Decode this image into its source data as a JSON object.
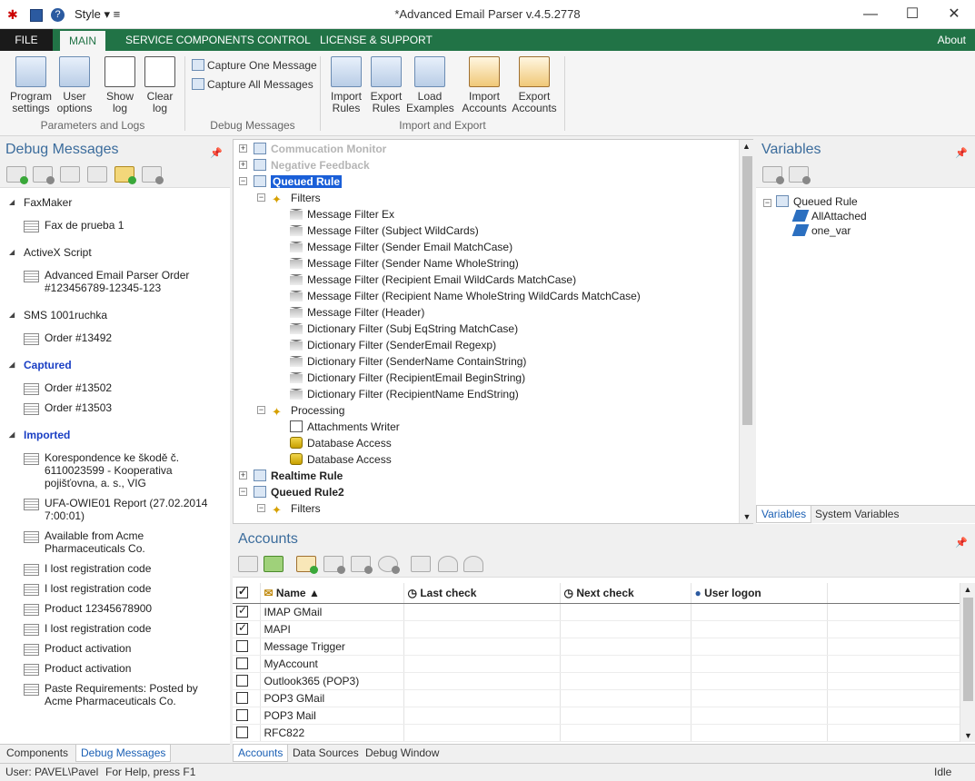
{
  "titlebar": {
    "title": "*Advanced Email Parser v.4.5.2778",
    "style_label": "Style"
  },
  "ribbon_tabs": [
    {
      "label": "FILE"
    },
    {
      "label": "MAIN"
    },
    {
      "label": "SERVICE COMPONENTS CONTROL"
    },
    {
      "label": "LICENSE & SUPPORT"
    }
  ],
  "about_label": "About",
  "ribbon": {
    "program_settings": "Program settings",
    "user_options": "User options",
    "show_log": "Show log",
    "clear_log": "Clear log",
    "group_params": "Parameters and Logs",
    "capture_one": "Capture One Message",
    "capture_all": "Capture All Messages",
    "group_debug": "Debug Messages",
    "import_rules": "Import Rules",
    "export_rules": "Export Rules",
    "load_examples": "Load Examples",
    "import_accounts": "Import Accounts",
    "export_accounts": "Export Accounts",
    "group_ie": "Import and Export"
  },
  "debug_panel": {
    "title": "Debug Messages",
    "groups": [
      {
        "name": "FaxMaker",
        "items": [
          "Fax de prueba 1"
        ]
      },
      {
        "name": "ActiveX Script",
        "items": [
          "Advanced Email Parser Order #123456789-12345-123"
        ]
      },
      {
        "name": "SMS 1001ruchka",
        "items": [
          "Order #13492"
        ]
      },
      {
        "name": "Captured",
        "items": [
          "Order #13502",
          "Order #13503"
        ]
      },
      {
        "name": "Imported",
        "items": [
          "Korespondence ke škodě č. 6110023599 - Kooperativa pojišťovna, a. s., VIG",
          "UFA-OWIE01 Report (27.02.2014 7:00:01)",
          "Available from Acme Pharmaceuticals Co.",
          "I lost registration code",
          "I lost registration code",
          "Product 12345678900",
          "I lost registration code",
          "Product activation",
          "Product activation",
          "Paste Requirements: Posted by Acme Pharmaceuticals Co."
        ]
      }
    ],
    "tabs": [
      "Components",
      "Debug Messages"
    ]
  },
  "rules_tree": [
    "Commucation Monitor",
    "Negative Feedback",
    "Queued Rule",
    "Filters",
    "Message Filter Ex",
    "Message Filter (Subject WildCards)",
    "Message Filter (Sender Email MatchCase)",
    "Message Filter (Sender Name WholeString)",
    "Message Filter (Recipient Email WildCards MatchCase)",
    "Message Filter (Recipient Name WholeString WildCards MatchCase)",
    "Message Filter (Header)",
    "Dictionary Filter (Subj EqString MatchCase)",
    "Dictionary Filter (SenderEmail Regexp)",
    "Dictionary Filter (SenderName ContainString)",
    "Dictionary Filter (RecipientEmail BeginString)",
    "Dictionary Filter (RecipientName EndString)",
    "Processing",
    "Attachments Writer",
    "Database Access",
    "Database Access",
    "Realtime Rule",
    "Queued Rule2",
    "Filters"
  ],
  "variables_panel": {
    "title": "Variables",
    "root": "Queued Rule",
    "vars": [
      "AllAttached",
      "one_var"
    ],
    "tabs": [
      "Variables",
      "System Variables"
    ]
  },
  "accounts_panel": {
    "title": "Accounts",
    "columns": [
      "Name",
      "Last check",
      "Next check",
      "User logon"
    ],
    "rows": [
      {
        "checked": true,
        "name": "IMAP GMail"
      },
      {
        "checked": true,
        "name": "MAPI"
      },
      {
        "checked": false,
        "name": "Message Trigger"
      },
      {
        "checked": false,
        "name": "MyAccount"
      },
      {
        "checked": false,
        "name": "Outlook365 (POP3)"
      },
      {
        "checked": false,
        "name": "POP3 GMail"
      },
      {
        "checked": false,
        "name": "POP3 Mail"
      },
      {
        "checked": false,
        "name": "RFC822"
      }
    ],
    "tabs": [
      "Accounts",
      "Data Sources",
      "Debug Window"
    ]
  },
  "status": {
    "user": "User: PAVEL\\Pavel",
    "help": "For Help, press F1",
    "state": "Idle"
  },
  "colors": {
    "accent": "#217346",
    "link": "#1a3fc4",
    "panel_title": "#3b6c9c"
  }
}
